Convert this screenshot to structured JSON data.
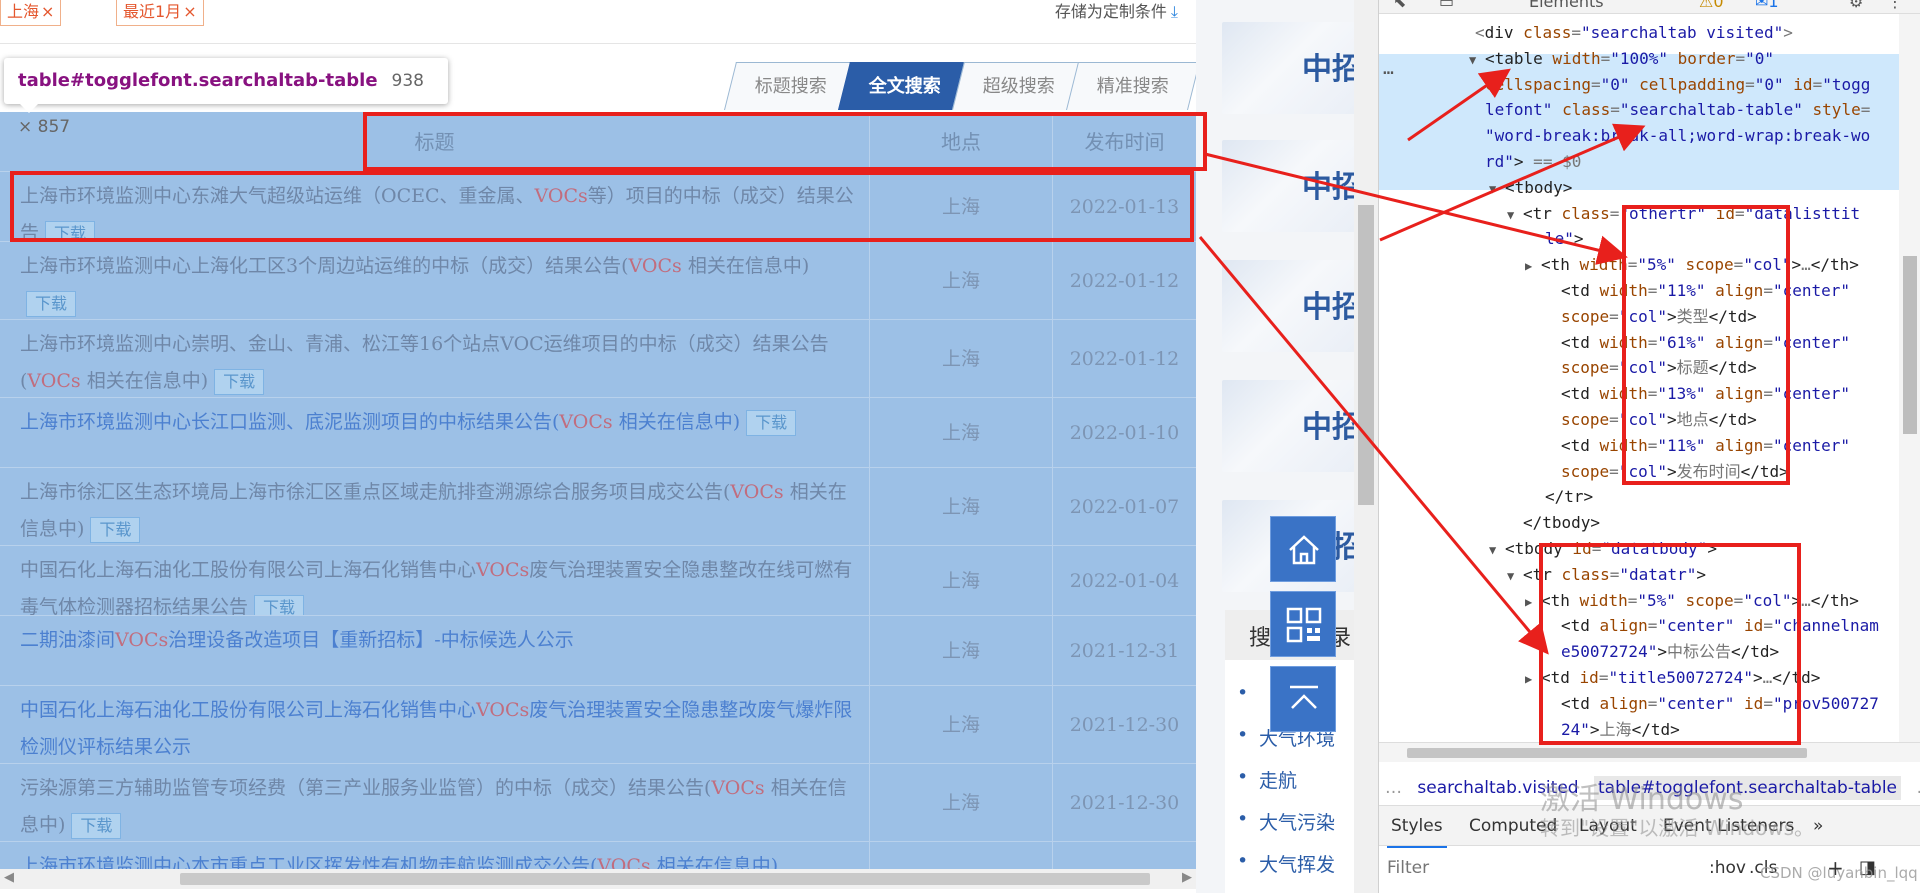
{
  "filters": {
    "chips": [
      {
        "label": "上海",
        "close": "×"
      },
      {
        "label": "最近1月",
        "close": "×"
      }
    ],
    "save_label": "存储为定制条件",
    "save_icon": "download-icon"
  },
  "search_tabs": [
    {
      "label": "标题搜索",
      "active": false
    },
    {
      "label": "全文搜索",
      "active": true
    },
    {
      "label": "超级搜索",
      "active": false
    },
    {
      "label": "精准搜索",
      "active": false
    }
  ],
  "inspect_tooltip": {
    "tag": "table",
    "selector": "#togglefont.searchaltab-table",
    "dims": "938 × 857"
  },
  "table": {
    "headers": {
      "title": "标题",
      "location": "地点",
      "date": "发布时间"
    },
    "download_label": "下载",
    "rows": [
      {
        "title_parts": [
          "上海市环境监测中心东滩大气超级站运维（OCEC、重金属、",
          "VOCs",
          "等）项目的中标（成交）结果公告"
        ],
        "download": true,
        "location": "上海",
        "date": "2022-01-13",
        "link": false
      },
      {
        "title_parts": [
          "上海市环境监测中心上海化工区3个周边站运维的中标（成交）结果公告(",
          "VOCs",
          " 相关在信息中)"
        ],
        "download": true,
        "location": "上海",
        "date": "2022-01-12",
        "link": false
      },
      {
        "title_parts": [
          "上海市环境监测中心崇明、金山、青浦、松江等16个站点VOC运维项目的中标（成交）结果公告(",
          "VOCs",
          " 相关在信息中)"
        ],
        "download": true,
        "location": "上海",
        "date": "2022-01-12",
        "link": false
      },
      {
        "title_parts": [
          "上海市环境监测中心长江口监测、底泥监测项目的中标结果公告(",
          "VOCs",
          " 相关在信息中)"
        ],
        "download": true,
        "location": "上海",
        "date": "2022-01-10",
        "link": true
      },
      {
        "title_parts": [
          "上海市徐汇区生态环境局上海市徐汇区重点区域走航排查溯源综合服务项目成交公告(",
          "VOCs",
          " 相关在信息中)"
        ],
        "download": true,
        "location": "上海",
        "date": "2022-01-07",
        "link": false
      },
      {
        "title_parts": [
          "中国石化上海石油化工股份有限公司上海石化销售中心",
          "VOCs",
          "废气治理装置安全隐患整改在线可燃有毒气体检测器招标结果公告"
        ],
        "download": true,
        "location": "上海",
        "date": "2022-01-04",
        "link": false
      },
      {
        "title_parts": [
          "二期油漆间",
          "VOCs",
          "治理设备改造项目【重新招标】-中标候选人公示"
        ],
        "download": false,
        "location": "上海",
        "date": "2021-12-31",
        "link": true
      },
      {
        "title_parts": [
          "中国石化上海石油化工股份有限公司上海石化销售中心",
          "VOCs",
          "废气治理装置安全隐患整改废气爆炸限检测仪评标结果公示"
        ],
        "download": false,
        "location": "上海",
        "date": "2021-12-30",
        "link": true
      },
      {
        "title_parts": [
          "污染源第三方辅助监管专项经费（第三产业服务业监管）的中标（成交）结果公告(",
          "VOCs",
          " 相关在信息中)"
        ],
        "download": true,
        "location": "上海",
        "date": "2021-12-30",
        "link": false
      },
      {
        "title_parts": [
          "上海市环境监测中心本市重点工业区挥发性有机物走航监测成交公告(",
          "VOCs",
          " 相关在信息中)"
        ],
        "download": false,
        "location": "",
        "date": "",
        "link": true
      }
    ]
  },
  "middle": {
    "banner_text": "中招",
    "panel_title": "搜",
    "panel_title_tail": "录",
    "panel_items": [
      "",
      "大气环境",
      "走航",
      "大气污染",
      "大气挥发"
    ],
    "float_buttons": [
      "home-icon",
      "qr-code-icon",
      "back-to-top-icon"
    ]
  },
  "devtools": {
    "top_tab": "Elements",
    "badges": {
      "warnings": "0",
      "messages": "1"
    },
    "dom_lines": [
      {
        "indent": 80,
        "tri": "",
        "parts": [
          [
            "g",
            "<"
          ],
          [
            "t",
            "div"
          ],
          [
            "a",
            " class"
          ],
          [
            "g",
            "="
          ],
          [
            "v",
            "\"searchaltab visited\""
          ],
          [
            "g",
            ">"
          ]
        ]
      },
      {
        "indent": 90,
        "tri": "▼",
        "parts": [
          [
            "t",
            "<table"
          ],
          [
            "a",
            " width"
          ],
          [
            "g",
            "="
          ],
          [
            "v",
            "\"100%\""
          ],
          [
            "a",
            " border"
          ],
          [
            "g",
            "="
          ],
          [
            "v",
            "\"0\""
          ]
        ]
      },
      {
        "indent": 90,
        "tri": "",
        "parts": [
          [
            "a",
            "cellspacing"
          ],
          [
            "g",
            "="
          ],
          [
            "v",
            "\"0\""
          ],
          [
            "a",
            " cellpadding"
          ],
          [
            "g",
            "="
          ],
          [
            "v",
            "\"0\""
          ],
          [
            "a",
            " id"
          ],
          [
            "g",
            "="
          ],
          [
            "v",
            "\"togg"
          ]
        ]
      },
      {
        "indent": 90,
        "tri": "",
        "parts": [
          [
            "v",
            "lefont\""
          ],
          [
            "a",
            " class"
          ],
          [
            "g",
            "="
          ],
          [
            "v",
            "\"searchaltab-table\""
          ],
          [
            "a",
            " style"
          ],
          [
            "g",
            "="
          ]
        ]
      },
      {
        "indent": 90,
        "tri": "",
        "parts": [
          [
            "v",
            "\"word-break:break-all;word-wrap:break-wo"
          ]
        ]
      },
      {
        "indent": 90,
        "tri": "",
        "parts": [
          [
            "v",
            "rd\""
          ],
          [
            "t",
            ">"
          ],
          [
            "g",
            " == $0"
          ]
        ]
      },
      {
        "indent": 110,
        "tri": "▼",
        "parts": [
          [
            "t",
            "<tbody>"
          ]
        ]
      },
      {
        "indent": 128,
        "tri": "▼",
        "parts": [
          [
            "t",
            "<tr"
          ],
          [
            "a",
            " class"
          ],
          [
            "g",
            "="
          ],
          [
            "v",
            "\"othertr\""
          ],
          [
            "a",
            " id"
          ],
          [
            "g",
            "="
          ],
          [
            "v",
            "\"datalisttit"
          ]
        ]
      },
      {
        "indent": 150,
        "tri": "",
        "parts": [
          [
            "v",
            "le\""
          ],
          [
            "t",
            ">"
          ]
        ]
      },
      {
        "indent": 146,
        "tri": "▶",
        "parts": [
          [
            "t",
            "<th"
          ],
          [
            "a",
            " width"
          ],
          [
            "g",
            "="
          ],
          [
            "v",
            "\"5%\""
          ],
          [
            "a",
            " scope"
          ],
          [
            "g",
            "="
          ],
          [
            "v",
            "\"col\""
          ],
          [
            "t",
            ">"
          ],
          [
            "g",
            "…"
          ],
          [
            "t",
            "</th>"
          ]
        ]
      },
      {
        "indent": 166,
        "tri": "",
        "parts": [
          [
            "t",
            "<td"
          ],
          [
            "a",
            " width"
          ],
          [
            "g",
            "="
          ],
          [
            "v",
            "\"11%\""
          ],
          [
            "a",
            " align"
          ],
          [
            "g",
            "="
          ],
          [
            "v",
            "\"center\""
          ]
        ]
      },
      {
        "indent": 166,
        "tri": "",
        "parts": [
          [
            "a",
            "scope"
          ],
          [
            "g",
            "="
          ],
          [
            "v",
            "\"col\""
          ],
          [
            "t",
            ">"
          ],
          [
            "g",
            "类型"
          ],
          [
            "t",
            "</td>"
          ]
        ]
      },
      {
        "indent": 166,
        "tri": "",
        "parts": [
          [
            "t",
            "<td"
          ],
          [
            "a",
            " width"
          ],
          [
            "g",
            "="
          ],
          [
            "v",
            "\"61%\""
          ],
          [
            "a",
            " align"
          ],
          [
            "g",
            "="
          ],
          [
            "v",
            "\"center\""
          ]
        ]
      },
      {
        "indent": 166,
        "tri": "",
        "parts": [
          [
            "a",
            "scope"
          ],
          [
            "g",
            "="
          ],
          [
            "v",
            "\"col\""
          ],
          [
            "t",
            ">"
          ],
          [
            "g",
            "标题"
          ],
          [
            "t",
            "</td>"
          ]
        ]
      },
      {
        "indent": 166,
        "tri": "",
        "parts": [
          [
            "t",
            "<td"
          ],
          [
            "a",
            " width"
          ],
          [
            "g",
            "="
          ],
          [
            "v",
            "\"13%\""
          ],
          [
            "a",
            " align"
          ],
          [
            "g",
            "="
          ],
          [
            "v",
            "\"center\""
          ]
        ]
      },
      {
        "indent": 166,
        "tri": "",
        "parts": [
          [
            "a",
            "scope"
          ],
          [
            "g",
            "="
          ],
          [
            "v",
            "\"col\""
          ],
          [
            "t",
            ">"
          ],
          [
            "g",
            "地点"
          ],
          [
            "t",
            "</td>"
          ]
        ]
      },
      {
        "indent": 166,
        "tri": "",
        "parts": [
          [
            "t",
            "<td"
          ],
          [
            "a",
            " width"
          ],
          [
            "g",
            "="
          ],
          [
            "v",
            "\"11%\""
          ],
          [
            "a",
            " align"
          ],
          [
            "g",
            "="
          ],
          [
            "v",
            "\"center\""
          ]
        ]
      },
      {
        "indent": 166,
        "tri": "",
        "parts": [
          [
            "a",
            "scope"
          ],
          [
            "g",
            "="
          ],
          [
            "v",
            "\"col\""
          ],
          [
            "t",
            ">"
          ],
          [
            "g",
            "发布时间"
          ],
          [
            "t",
            "</td>"
          ]
        ]
      },
      {
        "indent": 150,
        "tri": "",
        "parts": [
          [
            "t",
            "</tr>"
          ]
        ]
      },
      {
        "indent": 128,
        "tri": "",
        "parts": [
          [
            "t",
            "</tbody>"
          ]
        ]
      },
      {
        "indent": 110,
        "tri": "▼",
        "parts": [
          [
            "t",
            "<tbody"
          ],
          [
            "a",
            " id"
          ],
          [
            "g",
            "="
          ],
          [
            "v",
            "\"datatbody\""
          ],
          [
            "t",
            ">"
          ]
        ]
      },
      {
        "indent": 128,
        "tri": "▼",
        "parts": [
          [
            "t",
            "<tr"
          ],
          [
            "a",
            " class"
          ],
          [
            "g",
            "="
          ],
          [
            "v",
            "\"datatr\""
          ],
          [
            "t",
            ">"
          ]
        ]
      },
      {
        "indent": 146,
        "tri": "▶",
        "parts": [
          [
            "t",
            "<th"
          ],
          [
            "a",
            " width"
          ],
          [
            "g",
            "="
          ],
          [
            "v",
            "\"5%\""
          ],
          [
            "a",
            " scope"
          ],
          [
            "g",
            "="
          ],
          [
            "v",
            "\"col\""
          ],
          [
            "t",
            ">"
          ],
          [
            "g",
            "…"
          ],
          [
            "t",
            "</th>"
          ]
        ]
      },
      {
        "indent": 166,
        "tri": "",
        "parts": [
          [
            "t",
            "<td"
          ],
          [
            "a",
            " align"
          ],
          [
            "g",
            "="
          ],
          [
            "v",
            "\"center\""
          ],
          [
            "a",
            " id"
          ],
          [
            "g",
            "="
          ],
          [
            "v",
            "\"channelnam"
          ]
        ]
      },
      {
        "indent": 166,
        "tri": "",
        "parts": [
          [
            "v",
            "e50072724\""
          ],
          [
            "t",
            ">"
          ],
          [
            "g",
            "中标公告"
          ],
          [
            "t",
            "</td>"
          ]
        ]
      },
      {
        "indent": 146,
        "tri": "▶",
        "parts": [
          [
            "t",
            "<td"
          ],
          [
            "a",
            " id"
          ],
          [
            "g",
            "="
          ],
          [
            "v",
            "\"title50072724\""
          ],
          [
            "t",
            ">"
          ],
          [
            "g",
            "…"
          ],
          [
            "t",
            "</td>"
          ]
        ]
      },
      {
        "indent": 166,
        "tri": "",
        "parts": [
          [
            "t",
            "<td"
          ],
          [
            "a",
            " align"
          ],
          [
            "g",
            "="
          ],
          [
            "v",
            "\"center\""
          ],
          [
            "a",
            " id"
          ],
          [
            "g",
            "="
          ],
          [
            "v",
            "\"prov500727"
          ]
        ]
      },
      {
        "indent": 166,
        "tri": "",
        "parts": [
          [
            "v",
            "24\""
          ],
          [
            "t",
            ">"
          ],
          [
            "g",
            "上海"
          ],
          [
            "t",
            "</td>"
          ]
        ]
      }
    ],
    "dots": "…",
    "breadcrumb": {
      "lead": "…",
      "item1": "searchaltab.visited",
      "item2": "table#togglefont.searchaltab-table",
      "trail": "…"
    },
    "panel_tabs": [
      "Styles",
      "Computed",
      "Layout",
      "Event Listeners",
      "»"
    ],
    "filter_placeholder": "Filter",
    "hov": ":hov",
    "cls": ".cls",
    "plus": "+"
  },
  "watermark": {
    "line1": "激活 Windows",
    "line2": "转到\"设置\"以激活 Windows。"
  },
  "credit": "CSDN @luyanbin_lqq"
}
